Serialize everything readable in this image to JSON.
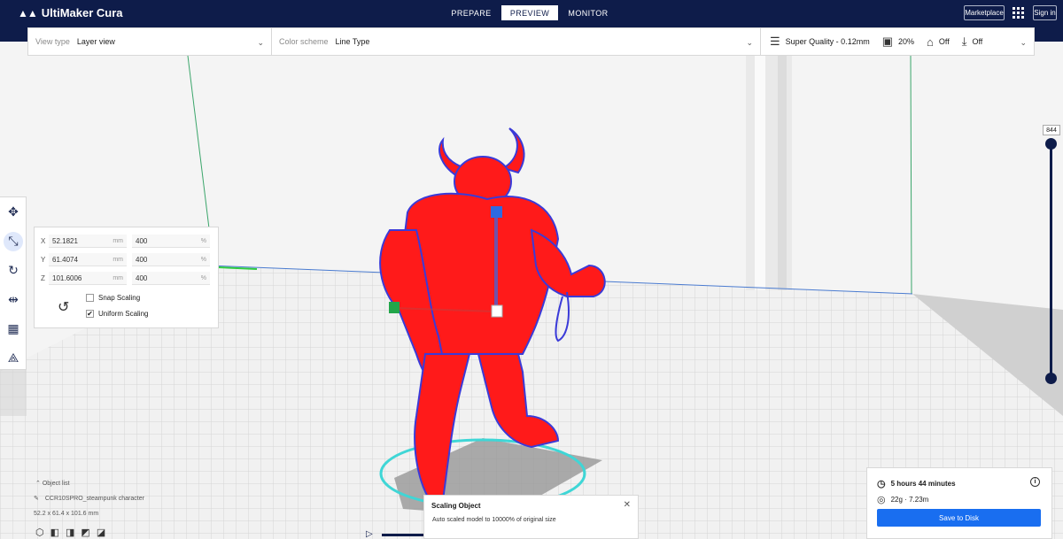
{
  "app": {
    "title": "UltiMaker Cura",
    "stages": [
      "PREPARE",
      "PREVIEW",
      "MONITOR"
    ],
    "active_stage": "PREVIEW",
    "marketplace_label": "Marketplace",
    "signin_label": "Sign in"
  },
  "settings_bar": {
    "view_type_label": "View type",
    "view_type_value": "Layer view",
    "color_scheme_label": "Color scheme",
    "color_scheme_value": "Line Type",
    "profile": "Super Quality - 0.12mm",
    "infill": "20%",
    "support": "Off",
    "adhesion": "Off"
  },
  "toolbar": {
    "tools": [
      "move-icon",
      "scale-icon",
      "rotate-icon",
      "mirror-icon",
      "per-model-settings-icon",
      "support-blocker-icon"
    ],
    "active_tool": "scale-icon"
  },
  "scale_panel": {
    "rows": [
      {
        "axis": "X",
        "mm": "52.1821",
        "unit": "mm",
        "percent": "400",
        "pct_unit": "%"
      },
      {
        "axis": "Y",
        "mm": "61.4074",
        "unit": "mm",
        "percent": "400",
        "pct_unit": "%"
      },
      {
        "axis": "Z",
        "mm": "101.6006",
        "unit": "mm",
        "percent": "400",
        "pct_unit": "%"
      }
    ],
    "snap_scaling_label": "Snap Scaling",
    "snap_scaling_checked": false,
    "uniform_scaling_label": "Uniform Scaling",
    "uniform_scaling_checked": true
  },
  "layer_slider": {
    "current_layer": "844"
  },
  "object_list": {
    "header": "Object list",
    "file_name": "CCR10SPRO_steampunk character",
    "dimensions": "52.2 x 61.4 x 101.6 mm"
  },
  "toast": {
    "title": "Scaling Object",
    "message": "Auto scaled model to 10000% of original size"
  },
  "print_panel": {
    "time": "5 hours 44 minutes",
    "material": "22g · 7.23m",
    "save_label": "Save to Disk"
  },
  "colors": {
    "header": "#0e1c4a",
    "accent": "#196ef0",
    "model": "#ff1a1a",
    "skirt": "#3fd6d6"
  }
}
